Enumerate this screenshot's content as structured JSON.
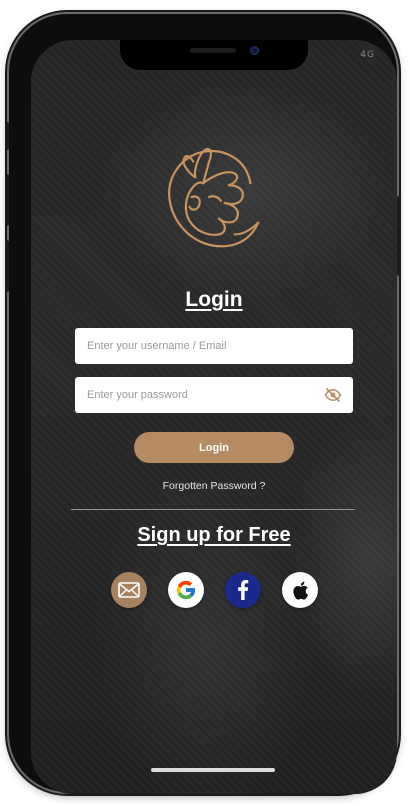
{
  "status_bar": {
    "network": "4G"
  },
  "app": {
    "logo_icon": "hand-ok-gesture-logo-icon",
    "accent": "#b58b63"
  },
  "login": {
    "title": "Login",
    "username_placeholder": "Enter your username / Email",
    "username_value": "",
    "password_placeholder": "Enter your password",
    "password_value": "",
    "password_toggle_icon": "eye-slash-icon",
    "submit_label": "Login",
    "forgot_label": "Forgotten Password ?"
  },
  "signup": {
    "label": "Sign up for Free"
  },
  "social": [
    {
      "name": "email",
      "icon": "envelope-icon",
      "bg": "#a7825f"
    },
    {
      "name": "google",
      "icon": "google-icon",
      "bg": "#ffffff"
    },
    {
      "name": "facebook",
      "icon": "facebook-icon",
      "bg": "#1a2a8c"
    },
    {
      "name": "apple",
      "icon": "apple-icon",
      "bg": "#ffffff"
    }
  ]
}
